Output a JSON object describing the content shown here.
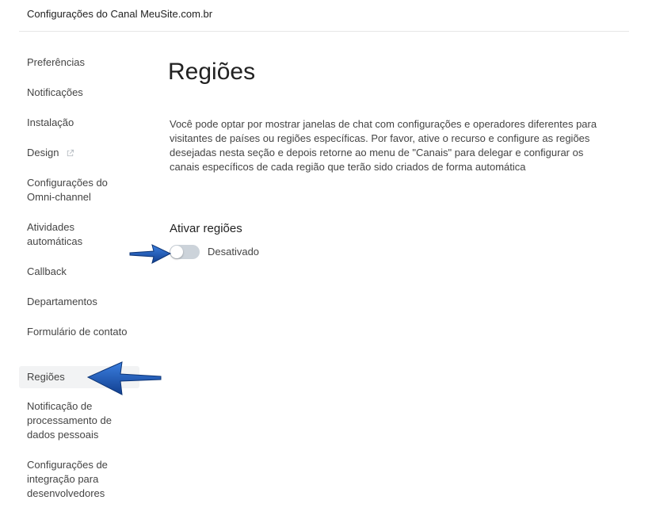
{
  "header": {
    "title": "Configurações do Canal MeuSite.com.br"
  },
  "sidebar": {
    "items": [
      {
        "label": "Preferências"
      },
      {
        "label": "Notificações"
      },
      {
        "label": "Instalação"
      },
      {
        "label": "Design",
        "icon": "external-link-icon"
      },
      {
        "label": "Configurações do Omni-channel"
      },
      {
        "label": "Atividades automáticas"
      },
      {
        "label": "Callback"
      },
      {
        "label": "Departamentos"
      },
      {
        "label": "Formulário de contato"
      },
      {
        "label": "Regiões",
        "active": true
      },
      {
        "label": "Notificação de processamento de dados pessoais"
      },
      {
        "label": "Configurações de integração para desenvolvedores"
      }
    ]
  },
  "main": {
    "title": "Regiões",
    "description": "Você pode optar por mostrar janelas de chat com configurações e operadores diferentes para visitantes de países ou regiões específicas. Por favor, ative o recurso e configure as regiões desejadas nesta seção e depois retorne ao menu de \"Canais\" para delegar e configurar os canais específicos de cada região que terão sido criados de forma automática",
    "section_title": "Ativar regiões",
    "toggle_state": false,
    "toggle_label": "Desativado"
  },
  "colors": {
    "annotation_arrow": "#1f5fbf",
    "toggle_off": "#ccd3da",
    "active_item_bg": "#f2f3f4"
  }
}
